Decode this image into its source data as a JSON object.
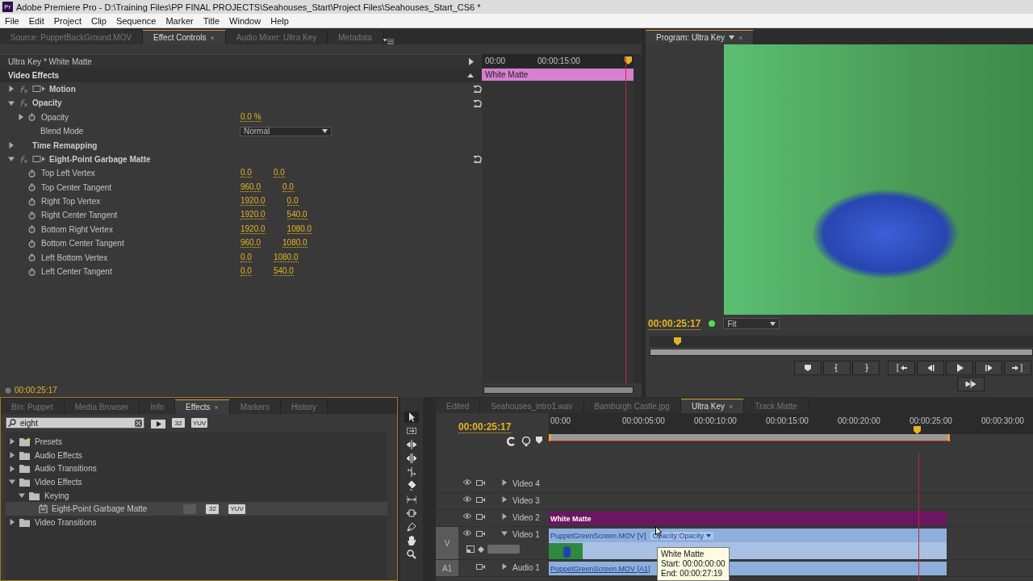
{
  "window": {
    "title": "Adobe Premiere Pro - D:\\Training Files\\PP FINAL PROJECTS\\Seahouses_Start\\Project Files\\Seahouses_Start_CS6 *",
    "app_badge": "Pr"
  },
  "menu": [
    "File",
    "Edit",
    "Project",
    "Clip",
    "Sequence",
    "Marker",
    "Title",
    "Window",
    "Help"
  ],
  "effect_controls": {
    "tabs": [
      {
        "label": "Source: PuppetBackGround.MOV",
        "selected": false
      },
      {
        "label": "Effect Controls",
        "selected": true,
        "close": "×"
      },
      {
        "label": "Audio Mixer: Ultra Key",
        "selected": false
      },
      {
        "label": "Metadata",
        "selected": false
      }
    ],
    "clip_title": "Ultra Key * White Matte",
    "section": "Video Effects",
    "effects": [
      {
        "name": "Motion",
        "kind": "transform",
        "expanded": false
      },
      {
        "name": "Opacity",
        "kind": "effect",
        "expanded": true,
        "params": [
          {
            "name": "Opacity",
            "kind": "value",
            "values": [
              "0.0 %"
            ]
          },
          {
            "name": "Blend Mode",
            "kind": "dropdown",
            "values": [
              "Normal"
            ]
          }
        ]
      },
      {
        "name": "Time Remapping",
        "kind": "remap",
        "expanded": false
      },
      {
        "name": "Eight-Point Garbage Matte",
        "kind": "transform",
        "expanded": true,
        "params": [
          {
            "name": "Top Left Vertex",
            "kind": "point",
            "values": [
              "0.0",
              "0.0"
            ]
          },
          {
            "name": "Top Center Tangent",
            "kind": "point",
            "values": [
              "960.0",
              "0.0"
            ]
          },
          {
            "name": "Right Top Vertex",
            "kind": "point",
            "values": [
              "1920.0",
              "0.0"
            ]
          },
          {
            "name": "Right Center Tangent",
            "kind": "point",
            "values": [
              "1920.0",
              "540.0"
            ]
          },
          {
            "name": "Bottom Right Vertex",
            "kind": "point",
            "values": [
              "1920.0",
              "1080.0"
            ]
          },
          {
            "name": "Bottom Center Tangent",
            "kind": "point",
            "values": [
              "960.0",
              "1080.0"
            ]
          },
          {
            "name": "Left Bottom Vertex",
            "kind": "point",
            "values": [
              "0.0",
              "1080.0"
            ]
          },
          {
            "name": "Left Center Tangent",
            "kind": "point",
            "values": [
              "0.0",
              "540.0"
            ]
          }
        ]
      }
    ],
    "ruler": [
      "00:00",
      "00:00:15:00"
    ],
    "clip": "White Matte",
    "timecode": "00:00:25:17"
  },
  "program_monitor": {
    "tab": "Program: Ultra Key",
    "close": "×",
    "timecode": "00:00:25:17",
    "zoom": "Fit"
  },
  "effects_panel": {
    "tabs": [
      {
        "label": "Bin: Puppet",
        "selected": false
      },
      {
        "label": "Media Browser",
        "selected": false
      },
      {
        "label": "Info",
        "selected": false
      },
      {
        "label": "Effects",
        "selected": true,
        "close": "×"
      },
      {
        "label": "Markers",
        "selected": false
      },
      {
        "label": "History",
        "selected": false
      }
    ],
    "search": {
      "value": "eight"
    },
    "badges": [
      "32",
      "YUV"
    ],
    "tree": [
      {
        "label": "Presets",
        "kind": "presets",
        "expanded": false,
        "selected": false
      },
      {
        "label": "Audio Effects",
        "kind": "folder",
        "expanded": false,
        "selected": false
      },
      {
        "label": "Audio Transitions",
        "kind": "folder",
        "expanded": false,
        "selected": false
      },
      {
        "label": "Video Effects",
        "kind": "folder",
        "expanded": true,
        "selected": false,
        "children": [
          {
            "label": "Keying",
            "kind": "folder",
            "expanded": true,
            "selected": false,
            "children": [
              {
                "label": "Eight-Point Garbage Matte",
                "kind": "effect",
                "selected": true,
                "badges": [
                  "32",
                  "YUV"
                ]
              }
            ]
          }
        ]
      },
      {
        "label": "Video Transitions",
        "kind": "folder",
        "expanded": false,
        "selected": false
      }
    ]
  },
  "timeline": {
    "tabs": [
      {
        "label": "Edited",
        "selected": false
      },
      {
        "label": "Seahouses_intro1.wav",
        "selected": false
      },
      {
        "label": "Bamburgh Castle.jpg",
        "selected": false
      },
      {
        "label": "Ultra Key",
        "selected": true,
        "close": "×"
      },
      {
        "label": "Track Matte",
        "selected": false
      }
    ],
    "timecode": "00:00:25:17",
    "ruler": [
      "00:00",
      "00:00:05:00",
      "00:00:10:00",
      "00:00:15:00",
      "00:00:20:00",
      "00:00:25:00",
      "00:00:30:00"
    ],
    "tracks": [
      {
        "name": "Video 4",
        "kind": "video",
        "expanded": false
      },
      {
        "name": "Video 3",
        "kind": "video",
        "expanded": false
      },
      {
        "name": "Video 2",
        "kind": "video",
        "expanded": false,
        "clip": {
          "label": "White Matte",
          "kind": "matte"
        }
      },
      {
        "name": "Video 1",
        "kind": "video",
        "expanded": true,
        "target": "V",
        "clip": {
          "label": "PuppetGreenScreen.MOV [V]",
          "kind": "footage",
          "effect": "Opacity:Opacity"
        }
      },
      {
        "name": "Audio 1",
        "kind": "audio",
        "expanded": false,
        "target": "A1",
        "clip": {
          "label": "PuppetGreenScreen.MOV [A1]",
          "kind": "footage"
        }
      }
    ],
    "tooltip": [
      "White Matte",
      "Start: 00:00:00:00",
      "End: 00:00:27:19"
    ]
  }
}
